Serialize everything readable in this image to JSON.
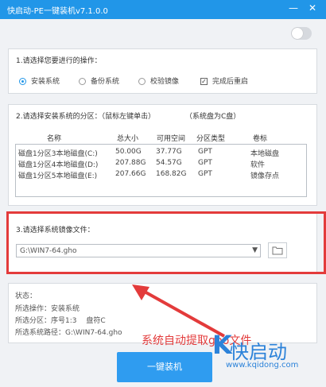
{
  "window": {
    "title": "快启动-PE一键装机v7.1.0.0",
    "minimize_icon": "minimize-icon",
    "close_icon": "close-icon"
  },
  "toggle": {
    "on": false
  },
  "section1": {
    "title": "1.请选择您要进行的操作：",
    "options": [
      {
        "label": "安装系统",
        "selected": true
      },
      {
        "label": "备份系统",
        "selected": false
      },
      {
        "label": "校验镜像",
        "selected": false
      }
    ],
    "checkbox": {
      "label": "完成后重启",
      "checked": true
    }
  },
  "section2": {
    "title": "2.请选择安装系统的分区：（鼠标左键单击）",
    "note": "（系统盘为C盘）",
    "columns": [
      "名称",
      "总大小",
      "可用空间",
      "分区类型",
      "卷标"
    ],
    "rows": [
      [
        "磁盘1分区3本地磁盘(C:)",
        "50.00G",
        "37.77G",
        "GPT",
        "本地磁盘"
      ],
      [
        "磁盘1分区4本地磁盘(D:)",
        "207.88G",
        "54.57G",
        "GPT",
        "软件"
      ],
      [
        "磁盘1分区5本地磁盘(E:)",
        "207.66G",
        "168.82G",
        "GPT",
        "镜像存点"
      ]
    ]
  },
  "section3": {
    "title": "3.请选择系统镜像文件：",
    "file_value": "G:\\WIN7-64.gho",
    "dropdown_icon": "chevron-down-icon",
    "folder_icon": "folder-icon"
  },
  "status": {
    "label": "状态：",
    "operation": "所选操作：安装系统",
    "partition": "所选分区：序号1:3　 盘符C",
    "path": "所选系统路径：G:\\WIN7-64.gho"
  },
  "main_button": {
    "label": "一键装机"
  },
  "annotation": {
    "text": "系统自动提取gho文件"
  },
  "logo": {
    "letter": "K",
    "name": "快启动",
    "url": "www.kqidong.com"
  },
  "colors": {
    "titlebar": "#2196e8",
    "highlight": "#e33b3b",
    "button": "#2f9cf0"
  }
}
